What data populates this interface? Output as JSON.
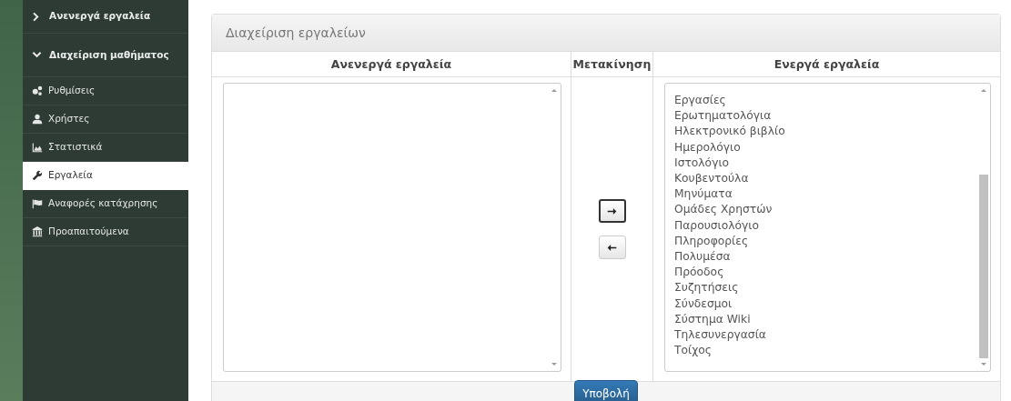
{
  "sidebar": {
    "sections": [
      {
        "label": "Ανενεργά εργαλεία",
        "expanded": false
      },
      {
        "label": "Διαχείριση μαθήματος",
        "expanded": true
      }
    ],
    "items": [
      {
        "label": "Ρυθμίσεις",
        "selected": false
      },
      {
        "label": "Χρήστες",
        "selected": false
      },
      {
        "label": "Στατιστικά",
        "selected": false
      },
      {
        "label": "Εργαλεία",
        "selected": true
      },
      {
        "label": "Αναφορές κατάχρησης",
        "selected": false
      },
      {
        "label": "Προαπαιτούμενα",
        "selected": false
      }
    ]
  },
  "panel": {
    "title": "Διαχείριση εργαλείων",
    "columns": [
      "Ανενεργά εργαλεία",
      "Μετακίνηση",
      "Ενεργά εργαλεία"
    ],
    "active_tools": [
      "Εργασίες",
      "Ερωτηματολόγια",
      "Ηλεκτρονικό βιβλίο",
      "Ημερολόγιο",
      "Ιστολόγιο",
      "Κουβεντούλα",
      "Μηνύματα",
      "Ομάδες Χρηστών",
      "Παρουσιολόγιο",
      "Πληροφορίες",
      "Πολυμέσα",
      "Πρόοδος",
      "Συζητήσεις",
      "Σύνδεσμοι",
      "Σύστημα Wiki",
      "Τηλεσυνεργασία",
      "Τοίχος"
    ],
    "move_buttons": [
      {
        "kind": "right",
        "focused": true
      },
      {
        "kind": "left",
        "focused": false
      }
    ],
    "submit": "Υποβολή"
  }
}
